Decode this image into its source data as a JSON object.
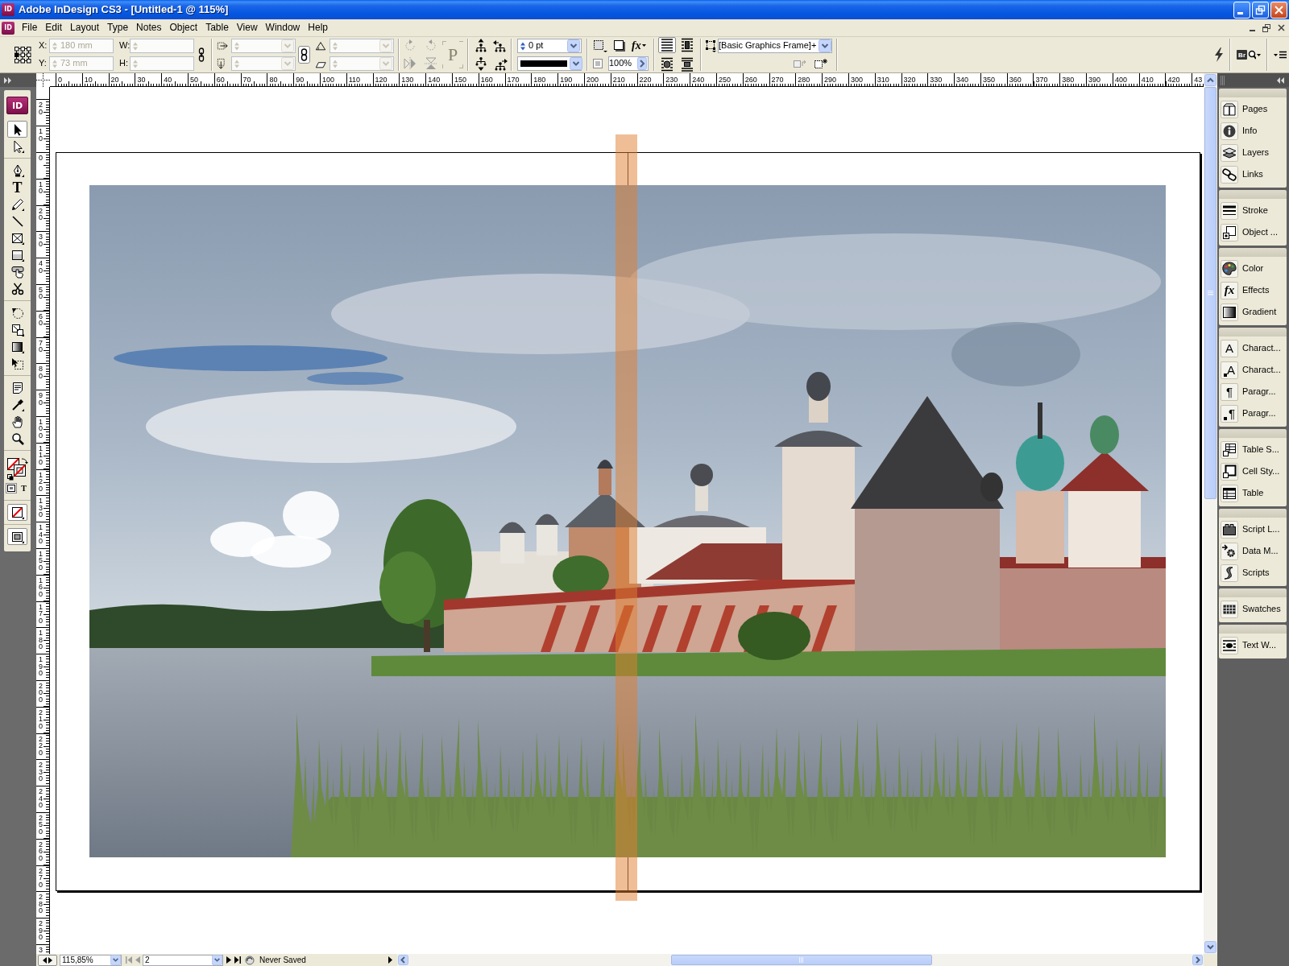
{
  "window": {
    "icon": "ID",
    "title": "Adobe InDesign CS3 - [Untitled-1 @ 115%]"
  },
  "menu_bar": {
    "logo": "ID",
    "items": [
      "File",
      "Edit",
      "Layout",
      "Type",
      "Notes",
      "Object",
      "Table",
      "View",
      "Window",
      "Help"
    ]
  },
  "control_panel": {
    "position_fields": [
      {
        "label": "X:",
        "value": "180 mm",
        "disabled": true
      },
      {
        "label": "Y:",
        "value": "73 mm",
        "disabled": true
      },
      {
        "label": "W:",
        "disabled": true
      },
      {
        "label": "H:",
        "disabled": true
      }
    ],
    "transform_fields": [
      {
        "kind": "scale-x",
        "disabled": true
      },
      {
        "kind": "scale-y",
        "disabled": true
      },
      {
        "kind": "rotation",
        "disabled": true
      },
      {
        "kind": "shear",
        "disabled": true
      }
    ],
    "transform_buttons": [
      {
        "kind": "rotate-clockwise",
        "disabled": true
      },
      {
        "kind": "rotate-counterclockwise",
        "disabled": true
      },
      {
        "kind": "flip-horizontal",
        "disabled": true
      },
      {
        "kind": "flip-vertical",
        "disabled": true
      }
    ],
    "frame_button": {
      "letter": "P",
      "disabled": true
    },
    "stroke_weight": "0 pt",
    "effects_label": "fx",
    "opacity": "100%",
    "text_wrap": [
      {
        "kind": "none",
        "selected": true
      },
      {
        "kind": "bounding-box",
        "selected": false
      },
      {
        "kind": "object-shape",
        "selected": false
      },
      {
        "kind": "jump-object",
        "selected": false
      }
    ],
    "object_style": "[Basic Graphics Frame]+",
    "style_buttons": [
      {
        "kind": "clear-overrides",
        "disabled": true
      },
      {
        "kind": "new-style",
        "disabled": false
      }
    ],
    "bridge_label": "Br"
  },
  "rulers": {
    "horizontal": [
      "0",
      "10",
      "20",
      "30",
      "40",
      "50",
      "60",
      "70",
      "80",
      "90",
      "100",
      "110",
      "120",
      "130",
      "140",
      "150",
      "160",
      "170",
      "180",
      "190",
      "200",
      "210",
      "220",
      "230",
      "240",
      "250",
      "260",
      "270",
      "280",
      "290",
      "300",
      "310",
      "320",
      "330",
      "340",
      "350",
      "360",
      "370",
      "380",
      "390",
      "400",
      "410",
      "420",
      "43"
    ],
    "vertical": [
      "20",
      "10",
      "0",
      "10",
      "20",
      "30",
      "40",
      "50",
      "60",
      "70",
      "80",
      "90",
      "100",
      "110",
      "120",
      "130",
      "140",
      "150",
      "160",
      "170",
      "180",
      "190",
      "200",
      "210",
      "220",
      "230",
      "240",
      "250",
      "260",
      "270",
      "280",
      "290",
      "3"
    ]
  },
  "toolbox": {
    "logo": "ID",
    "groups": [
      {
        "tools": [
          {
            "kind": "selection",
            "selected": true
          },
          {
            "kind": "direct-selection",
            "selected": false
          }
        ]
      },
      {
        "tools": [
          {
            "kind": "pen",
            "selected": false
          },
          {
            "kind": "type",
            "glyph": "T",
            "selected": false
          },
          {
            "kind": "pencil",
            "selected": false
          },
          {
            "kind": "line",
            "selected": false
          },
          {
            "kind": "rectangle-frame",
            "selected": false
          },
          {
            "kind": "rectangle",
            "selected": false
          },
          {
            "kind": "button",
            "selected": false
          },
          {
            "kind": "scissors",
            "selected": false
          }
        ]
      },
      {
        "tools": [
          {
            "kind": "rotate",
            "selected": false
          },
          {
            "kind": "scale",
            "selected": false
          },
          {
            "kind": "gradient",
            "selected": false
          },
          {
            "kind": "free-transform",
            "selected": false
          }
        ]
      },
      {
        "tools": [
          {
            "kind": "note",
            "selected": false
          },
          {
            "kind": "eyedropper",
            "selected": false
          },
          {
            "kind": "hand",
            "selected": false
          },
          {
            "kind": "zoom",
            "selected": false
          }
        ]
      }
    ],
    "formatting": [
      {
        "kind": "container",
        "selected": true
      },
      {
        "kind": "text",
        "glyph": "T",
        "selected": false
      }
    ]
  },
  "panel_dock": {
    "groups": [
      {
        "items": [
          {
            "kind": "pages",
            "label": "Pages"
          },
          {
            "kind": "info",
            "label": "Info"
          },
          {
            "kind": "layers",
            "label": "Layers"
          },
          {
            "kind": "links",
            "label": "Links"
          }
        ]
      },
      {
        "items": [
          {
            "kind": "stroke",
            "label": "Stroke"
          },
          {
            "kind": "object-styles",
            "label": "Object ..."
          }
        ]
      },
      {
        "items": [
          {
            "kind": "color",
            "label": "Color"
          },
          {
            "kind": "effects",
            "glyph": "fx",
            "label": "Effects"
          },
          {
            "kind": "gradient",
            "label": "Gradient"
          }
        ]
      },
      {
        "items": [
          {
            "kind": "character",
            "glyph": "A",
            "label": "Charact..."
          },
          {
            "kind": "character-styles",
            "glyph": "A",
            "label": "Charact..."
          },
          {
            "kind": "paragraph",
            "glyph": "¶",
            "label": "Paragr..."
          },
          {
            "kind": "paragraph-styles",
            "glyph": "¶",
            "label": "Paragr..."
          }
        ]
      },
      {
        "items": [
          {
            "kind": "table-styles",
            "label": "Table S..."
          },
          {
            "kind": "cell-styles",
            "label": "Cell Sty..."
          },
          {
            "kind": "table",
            "label": "Table"
          }
        ]
      },
      {
        "items": [
          {
            "kind": "script-label",
            "label": "Script L..."
          },
          {
            "kind": "data-merge",
            "label": "Data M..."
          },
          {
            "kind": "scripts",
            "label": "Scripts"
          }
        ]
      },
      {
        "items": [
          {
            "kind": "swatches",
            "label": "Swatches"
          }
        ]
      },
      {
        "items": [
          {
            "kind": "text-wrap",
            "label": "Text W..."
          }
        ]
      }
    ]
  },
  "status_bar": {
    "zoom": "115,85%",
    "back_buttons": [
      {
        "kind": "first",
        "disabled": true
      },
      {
        "kind": "previous",
        "disabled": true
      }
    ],
    "page": "2",
    "forward_buttons": [
      {
        "kind": "next",
        "disabled": false
      },
      {
        "kind": "last",
        "disabled": false
      }
    ],
    "save_state": "Never Saved"
  }
}
